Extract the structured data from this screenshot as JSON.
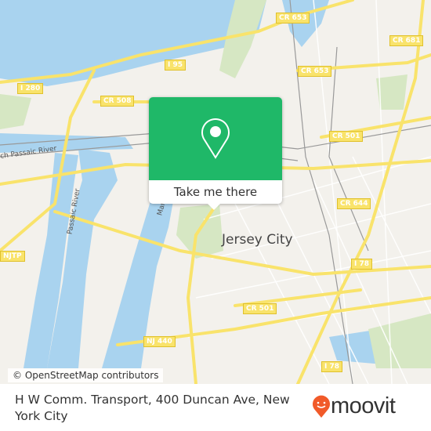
{
  "map": {
    "city_label": "Jersey City",
    "road_shields": [
      "CR 653",
      "CR 681",
      "I 95",
      "CR 653",
      "I 280",
      "CR 508",
      "CR 501",
      "CR 644",
      "I 78",
      "CR 501",
      "NJ 440",
      "I 78",
      "NJTP"
    ],
    "water_labels": [
      "ch Passaic River",
      "Passaic River",
      "Mang"
    ],
    "colors": {
      "land": "#f3f1ec",
      "water": "#a9d3ef",
      "park": "#d6e7c3",
      "road": "#f9e36b"
    }
  },
  "popup": {
    "icon": "map-pin-icon",
    "button_label": "Take me there",
    "color": "#1fb868"
  },
  "attribution": "© OpenStreetMap contributors",
  "footer": {
    "title": "H W Comm. Transport, 400 Duncan Ave, New York City",
    "logo": "moovit",
    "logo_color": "#f15a29"
  }
}
